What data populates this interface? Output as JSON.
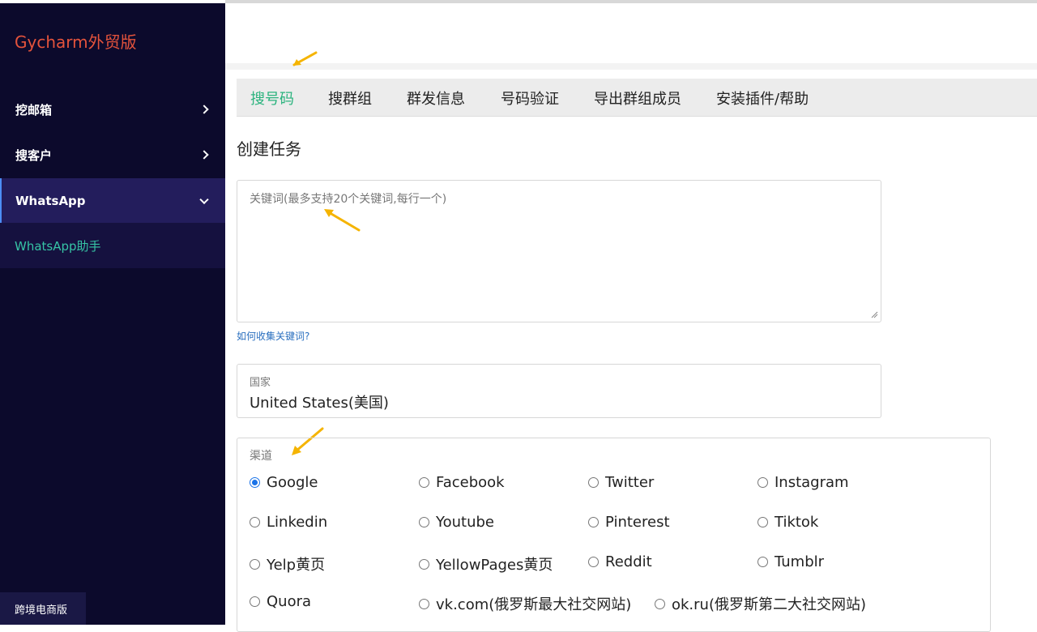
{
  "sidebar": {
    "brand": "Gycharm外贸版",
    "items": [
      {
        "label": "挖邮箱"
      },
      {
        "label": "搜客户"
      },
      {
        "label": "WhatsApp"
      }
    ],
    "submenu": {
      "label": "WhatsApp助手"
    },
    "footer": "跨境电商版"
  },
  "tabs": [
    {
      "label": "搜号码"
    },
    {
      "label": "搜群组"
    },
    {
      "label": "群发信息"
    },
    {
      "label": "号码验证"
    },
    {
      "label": "导出群组成员"
    },
    {
      "label": "安装插件/帮助"
    }
  ],
  "form": {
    "title": "创建任务",
    "keywords_placeholder": "关键词(最多支持20个关键词,每行一个)",
    "help_link": "如何收集关键词?",
    "country_label": "国家",
    "country_value": "United States(美国)",
    "channel_label": "渠道",
    "channels": [
      {
        "label": "Google",
        "checked": true
      },
      {
        "label": "Facebook",
        "checked": false
      },
      {
        "label": "Twitter",
        "checked": false
      },
      {
        "label": "Instagram",
        "checked": false
      },
      {
        "label": "Linkedin",
        "checked": false
      },
      {
        "label": "Youtube",
        "checked": false
      },
      {
        "label": "Pinterest",
        "checked": false
      },
      {
        "label": "Tiktok",
        "checked": false
      },
      {
        "label": "Yelp黄页",
        "checked": false
      },
      {
        "label": "YellowPages黄页",
        "checked": false
      },
      {
        "label": "Reddit",
        "checked": false
      },
      {
        "label": "Tumblr",
        "checked": false
      },
      {
        "label": "Quora",
        "checked": false
      },
      {
        "label": "vk.com(俄罗斯最大社交网站)",
        "checked": false
      },
      {
        "label": "ok.ru(俄罗斯第二大社交网站)",
        "checked": false
      }
    ]
  },
  "colors": {
    "sidebar_bg": "#0c0a2c",
    "brand": "#e4533c",
    "active_tab": "#2bb37e",
    "submenu_text": "#36c4a5",
    "link": "#2a6fbf",
    "annotation_arrow": "#f5b400"
  }
}
